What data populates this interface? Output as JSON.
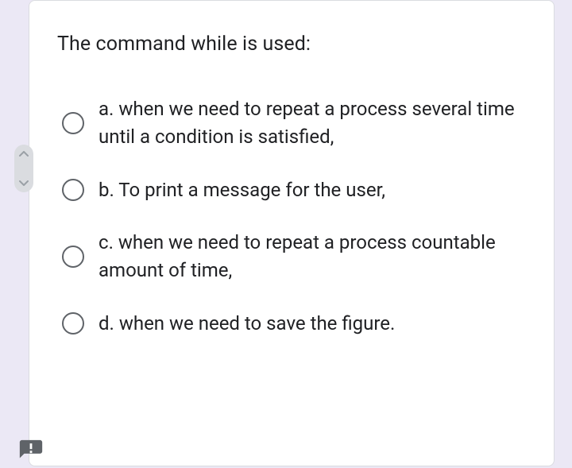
{
  "question": "The command while is used:",
  "options": [
    {
      "label": "a. when we need to repeat a process several time until a condition is satisfied,"
    },
    {
      "label": "b. To print a message for the user,"
    },
    {
      "label": "c. when we need to repeat a process countable amount of time,"
    },
    {
      "label": "d. when we need to save the figure."
    }
  ]
}
